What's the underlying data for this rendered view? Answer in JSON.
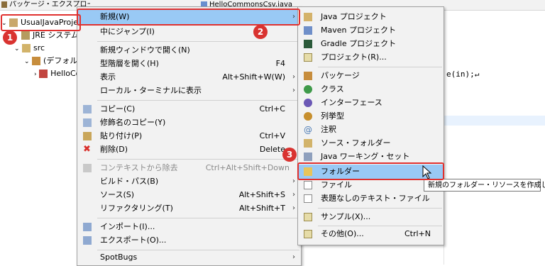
{
  "tabs": {
    "explorer": "パッケージ・エクスプローラー",
    "editor": "HelloCommonsCsv.java"
  },
  "tree": {
    "project": "UsualJavaProject",
    "jre": "JRE システム・ライブラリー",
    "src": "src",
    "default_pkg": "(デフォルト・パッケージ)",
    "hello": "HelloCommonsCsv.java"
  },
  "editor": {
    "code_fragment": "e(in);↵"
  },
  "context_menu": {
    "new": {
      "label": "新規(W)"
    },
    "goto": {
      "label": "中にジャンプ(I)"
    },
    "open_window": {
      "label": "新規ウィンドウで開く(N)"
    },
    "open_type_hierarchy": {
      "label": "型階層を開く(H)",
      "accel": "F4"
    },
    "show_in": {
      "label": "表示",
      "accel": "Alt+Shift+W(W)"
    },
    "show_in_terminal": {
      "label": "ローカル・ターミナルに表示"
    },
    "copy": {
      "label": "コピー(C)",
      "accel": "Ctrl+C"
    },
    "copy_qualified": {
      "label": "修飾名のコピー(Y)"
    },
    "paste": {
      "label": "貼り付け(P)",
      "accel": "Ctrl+V"
    },
    "delete": {
      "label": "削除(D)",
      "accel": "Delete"
    },
    "remove_context": {
      "label": "コンテキストから除去",
      "accel": "Ctrl+Alt+Shift+Down"
    },
    "build_path": {
      "label": "ビルド・パス(B)"
    },
    "source": {
      "label": "ソース(S)",
      "accel": "Alt+Shift+S"
    },
    "refactor": {
      "label": "リファクタリング(T)",
      "accel": "Alt+Shift+T"
    },
    "import": {
      "label": "インポート(I)..."
    },
    "export": {
      "label": "エクスポート(O)..."
    },
    "spotbugs": {
      "label": "SpotBugs"
    }
  },
  "submenu": {
    "items": [
      {
        "label": "Java プロジェクト"
      },
      {
        "label": "Maven プロジェクト"
      },
      {
        "label": "Gradle プロジェクト"
      },
      {
        "label": "プロジェクト(R)..."
      },
      {
        "label": "パッケージ"
      },
      {
        "label": "クラス"
      },
      {
        "label": "インターフェース"
      },
      {
        "label": "列挙型"
      },
      {
        "label": "注釈"
      },
      {
        "label": "ソース・フォルダー"
      },
      {
        "label": "Java ワーキング・セット"
      },
      {
        "label": "フォルダー"
      },
      {
        "label": "ファイル"
      },
      {
        "label": "表題なしのテキスト・ファイル"
      },
      {
        "label": "サンプル(X)..."
      },
      {
        "label": "その他(O)...",
        "accel": "Ctrl+N"
      }
    ]
  },
  "tooltip": "新規のフォルダー・リソースを作成します",
  "badges": [
    "1",
    "2",
    "3"
  ],
  "colors": {
    "highlight": "#99c9f5",
    "annotation_red": "#e0312f"
  }
}
